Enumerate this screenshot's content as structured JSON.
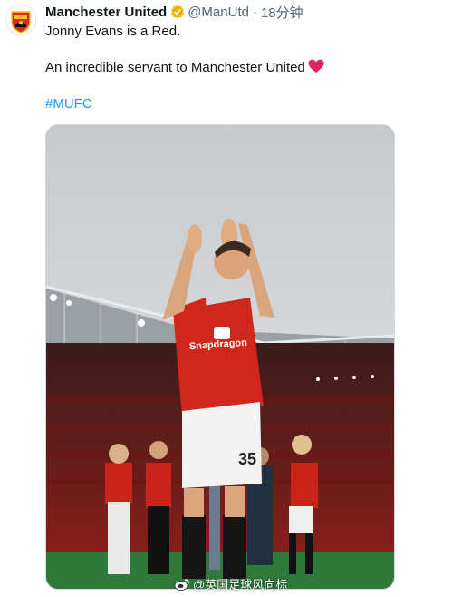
{
  "tweet": {
    "author_name": "Manchester United",
    "handle": "@ManUtd",
    "separator": "·",
    "time": "18分钟",
    "line1": "Jonny Evans is a Red.",
    "line2": "An incredible servant to Manchester United",
    "hashtag": "#MUFC"
  },
  "media": {
    "shirt_number": "35",
    "sponsor_text": "Snapdragon",
    "watermark": "@英国足球风向标"
  },
  "colors": {
    "verified": "#f2b600",
    "hashtag": "#1d9bf0",
    "heart": "#e0245e",
    "kit_red": "#d0261b"
  },
  "icons": {
    "verified": "verified-badge-icon",
    "heart": "red-heart-icon",
    "avatar": "club-crest-icon",
    "watermark": "weibo-icon"
  }
}
